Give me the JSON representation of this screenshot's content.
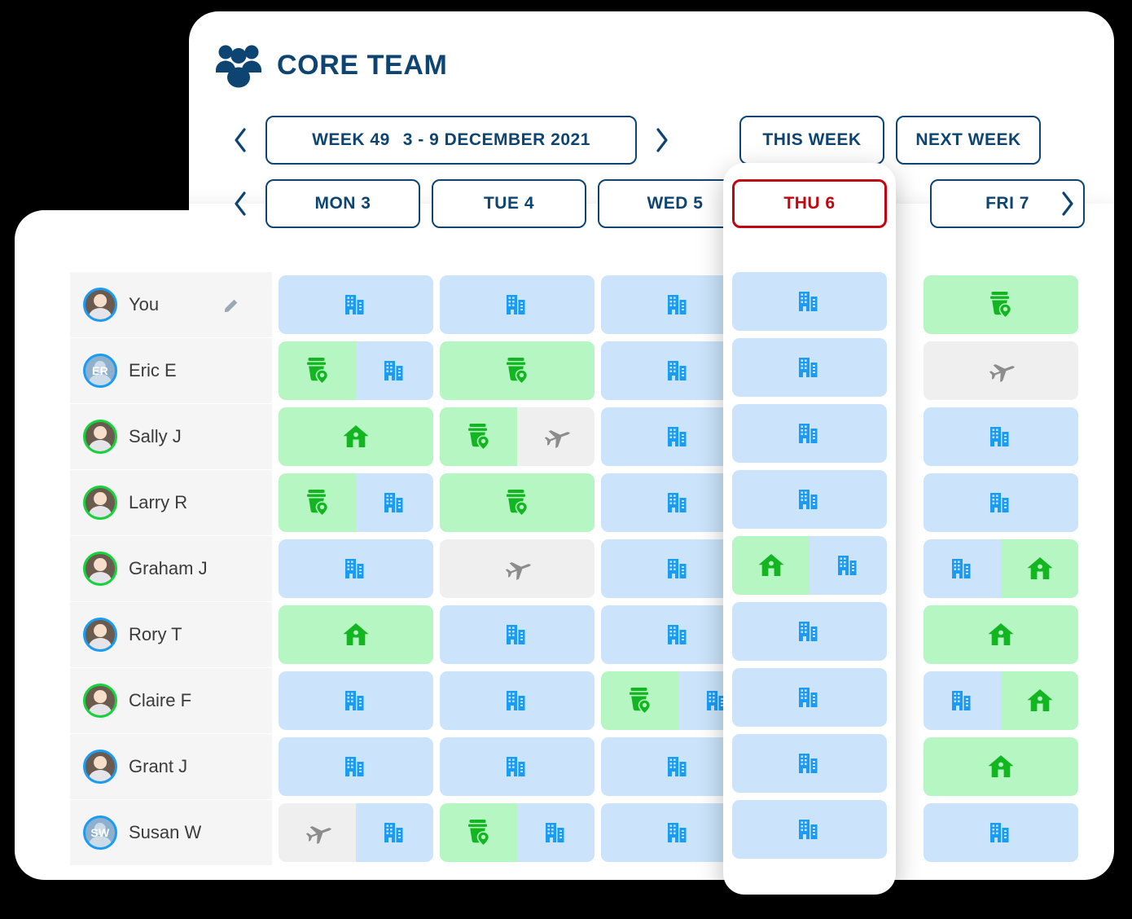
{
  "header": {
    "title": "CORE TEAM",
    "icon": "people-group-icon"
  },
  "week_nav": {
    "prev_icon": "chevron-left-icon",
    "next_icon": "chevron-right-icon",
    "week_label": "WEEK 49",
    "date_range": "3 - 9 DECEMBER 2021",
    "this_week_label": "THIS WEEK",
    "next_week_label": "NEXT WEEK"
  },
  "day_nav": {
    "prev_icon": "chevron-left-icon",
    "next_icon": "chevron-right-icon",
    "days": [
      {
        "label": "MON 3",
        "selected": false
      },
      {
        "label": "TUE 4",
        "selected": false
      },
      {
        "label": "WED 5",
        "selected": false
      },
      {
        "label": "THU 6",
        "selected": true
      },
      {
        "label": "FRI 7",
        "selected": false
      }
    ],
    "selected_day": "THU 6"
  },
  "colors": {
    "brand_navy": "#0d4472",
    "selected_red": "#c4050f",
    "office_bg": "#cbe4fb",
    "office_icon": "#1a9cf5",
    "home_bg": "#b5f6c3",
    "home_icon": "#13b520",
    "cafe_bg": "#b5f6c3",
    "cafe_icon": "#13b520",
    "travel_bg": "#efefef",
    "travel_icon": "#8c8c8c",
    "row_bg": "#f5f5f5"
  },
  "legend": {
    "office": "office-building-icon",
    "home": "home-icon",
    "cafe": "coffee-location-icon",
    "travel": "airplane-icon"
  },
  "people": [
    {
      "name": "You",
      "initials": "",
      "ring": "blue",
      "photo": true,
      "editable": true
    },
    {
      "name": "Eric E",
      "initials": "ER",
      "ring": "blue",
      "photo": false,
      "editable": false
    },
    {
      "name": "Sally J",
      "initials": "",
      "ring": "green",
      "photo": true,
      "editable": false
    },
    {
      "name": "Larry R",
      "initials": "",
      "ring": "green",
      "photo": true,
      "editable": false
    },
    {
      "name": "Graham J",
      "initials": "",
      "ring": "green",
      "photo": true,
      "editable": false
    },
    {
      "name": "Rory T",
      "initials": "",
      "ring": "blue",
      "photo": true,
      "editable": false
    },
    {
      "name": "Claire F",
      "initials": "",
      "ring": "green",
      "photo": true,
      "editable": false
    },
    {
      "name": "Grant J",
      "initials": "",
      "ring": "blue",
      "photo": true,
      "editable": false
    },
    {
      "name": "Susan W",
      "initials": "SW",
      "ring": "blue",
      "photo": false,
      "editable": false
    }
  ],
  "schedule": {
    "columns": [
      "MON 3",
      "TUE 4",
      "WED 5",
      "THU 6",
      "FRI 7"
    ],
    "rows": [
      {
        "person": "You",
        "cells": [
          [
            "office"
          ],
          [
            "office"
          ],
          [
            "office"
          ],
          [
            "office"
          ],
          [
            "cafe"
          ]
        ]
      },
      {
        "person": "Eric E",
        "cells": [
          [
            "cafe",
            "office"
          ],
          [
            "cafe"
          ],
          [
            "office"
          ],
          [
            "office"
          ],
          [
            "travel"
          ]
        ]
      },
      {
        "person": "Sally J",
        "cells": [
          [
            "home"
          ],
          [
            "cafe",
            "travel"
          ],
          [
            "office"
          ],
          [
            "office"
          ],
          [
            "office"
          ]
        ]
      },
      {
        "person": "Larry R",
        "cells": [
          [
            "cafe",
            "office"
          ],
          [
            "cafe"
          ],
          [
            "office"
          ],
          [
            "office"
          ],
          [
            "office"
          ]
        ]
      },
      {
        "person": "Graham J",
        "cells": [
          [
            "office"
          ],
          [
            "travel"
          ],
          [
            "office"
          ],
          [
            "home",
            "office"
          ],
          [
            "office",
            "home"
          ]
        ]
      },
      {
        "person": "Rory T",
        "cells": [
          [
            "home"
          ],
          [
            "office"
          ],
          [
            "office"
          ],
          [
            "office"
          ],
          [
            "home"
          ]
        ]
      },
      {
        "person": "Claire F",
        "cells": [
          [
            "office"
          ],
          [
            "office"
          ],
          [
            "cafe",
            "office"
          ],
          [
            "office"
          ],
          [
            "office",
            "home"
          ]
        ]
      },
      {
        "person": "Grant J",
        "cells": [
          [
            "office"
          ],
          [
            "office"
          ],
          [
            "office"
          ],
          [
            "office"
          ],
          [
            "home"
          ]
        ]
      },
      {
        "person": "Susan W",
        "cells": [
          [
            "travel",
            "office"
          ],
          [
            "cafe",
            "office"
          ],
          [
            "office"
          ],
          [
            "office"
          ],
          [
            "office"
          ]
        ]
      }
    ]
  }
}
